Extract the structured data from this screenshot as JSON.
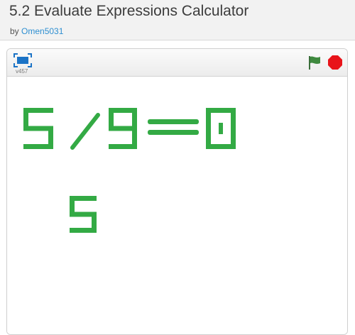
{
  "project": {
    "title": "5.2 Evaluate Expressions Calculator",
    "by_prefix": "by",
    "author": "Omen5031"
  },
  "player": {
    "version": "v457",
    "icons": {
      "fullscreen": "fullscreen-icon",
      "green_flag": "green-flag-icon",
      "stop": "stop-sign-icon"
    },
    "colors": {
      "digit_green": "#33aa44",
      "flag": "#3a7a3a",
      "stop": "#e8141a",
      "fullscreen": "#1b73c6"
    }
  },
  "stage": {
    "expression_line": [
      "5",
      "/",
      "9",
      "=",
      "0"
    ],
    "input_line": "5"
  }
}
